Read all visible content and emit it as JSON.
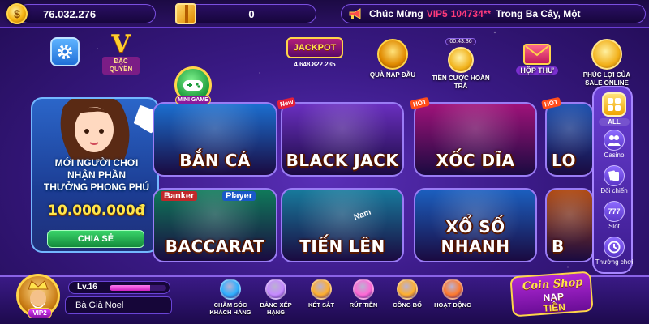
{
  "topbar": {
    "coins": "76.032.276",
    "gift_value": "0",
    "marquee": {
      "prefix": "Chúc Mừng",
      "vip": "VIP5",
      "user_id": "104734**",
      "suffix": "Trong Ba Cây, Một"
    }
  },
  "header": {
    "dac_quyen": "ĐẶC QUYỀN",
    "jackpot": {
      "label": "JACKPOT",
      "value": "4.648.822.235"
    },
    "features": [
      {
        "label": "QUÀ NẠP ĐẦU",
        "icon": "treasure-pot-icon"
      },
      {
        "label": "TIỀN CƯỢC HOÀN TRẢ",
        "timer": "00:43:36",
        "icon": "piggy-icon"
      },
      {
        "label": "HỘP THƯ",
        "icon": "mail-icon"
      },
      {
        "label": "PHÚC LỢI CỦA SALE ONLINE",
        "icon": "coin-bag-icon"
      }
    ]
  },
  "promo": {
    "line1": "MỚI NGƯỜI CHƠI",
    "line2": "NHẬN PHẦN",
    "line3": "THƯỞNG PHONG PHÚ",
    "amount": "10.000.000đ",
    "share_label": "CHIA SẺ"
  },
  "minigame": {
    "label": "MINI GAME"
  },
  "games": [
    {
      "title": "BẮN CÁ",
      "badge": "",
      "bg": "#1b6fd0"
    },
    {
      "title": "BLACK JACK",
      "badge": "New",
      "bg": "#6a2fc0"
    },
    {
      "title": "XỐC DĨA",
      "badge": "HOT",
      "bg": "#a0127a"
    },
    {
      "title": "LO",
      "badge": "HOT",
      "bg": "#1a4fae"
    },
    {
      "title": "BACCARAT",
      "badge": "",
      "bg": "#0f7a5a"
    },
    {
      "title": "TIẾN LÊN",
      "badge": "",
      "bg": "#177a9c"
    },
    {
      "title": "XỔ SỐ NHANH",
      "badge": "",
      "bg": "#1b5fbf"
    },
    {
      "title": "B",
      "badge": "",
      "bg": "#b04a12"
    }
  ],
  "tile_labels": {
    "banker": "Banker",
    "player": "Player",
    "nam": "Nam"
  },
  "sidebar": {
    "items": [
      {
        "label": "ALL"
      },
      {
        "label": "Casino"
      },
      {
        "label": "Đối chiến"
      },
      {
        "label": "Slot"
      },
      {
        "label": "Thường chơi"
      }
    ]
  },
  "user": {
    "level": "Lv.16",
    "level_progress": 0.72,
    "name": "Bà Già Noel",
    "vip": "VIP2"
  },
  "bottom_menu": [
    {
      "label": "CHĂM SÓC KHÁCH HÀNG",
      "color": "#2fb0ff"
    },
    {
      "label": "BẢNG XẾP HẠNG",
      "color": "#c68bff"
    },
    {
      "label": "KÉT SẮT",
      "color": "#ffb02e"
    },
    {
      "label": "RÚT TIỀN",
      "color": "#ff6ad5"
    },
    {
      "label": "CÔNG BỐ",
      "color": "#ffb02e"
    },
    {
      "label": "HOẠT ĐỘNG",
      "color": "#ff7a2e"
    }
  ],
  "shop": {
    "line1": "Coin Shop",
    "line2": "NẠP",
    "line3": "TIỀN"
  }
}
